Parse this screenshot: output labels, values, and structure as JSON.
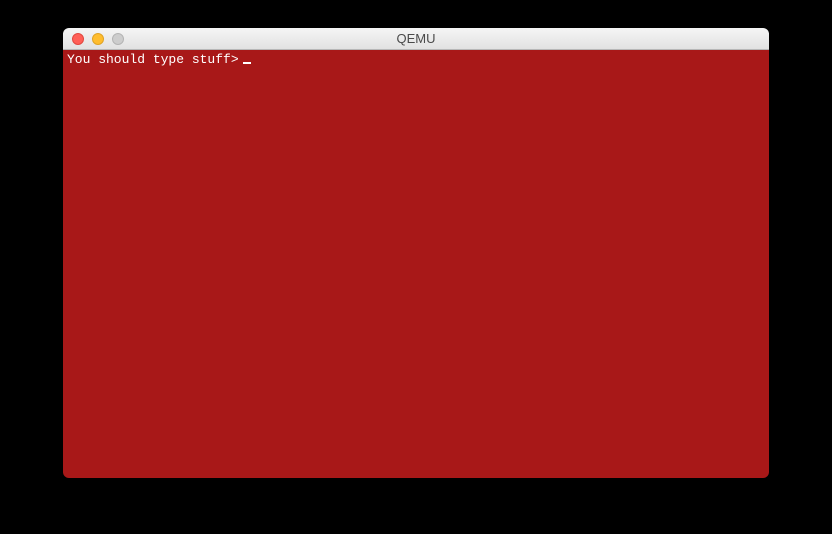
{
  "window": {
    "title": "QEMU"
  },
  "terminal": {
    "prompt": "You should type stuff>",
    "input": "",
    "background_color": "#a81818",
    "text_color": "#ffffff"
  },
  "traffic_lights": {
    "close": "close",
    "minimize": "minimize",
    "maximize": "maximize"
  }
}
